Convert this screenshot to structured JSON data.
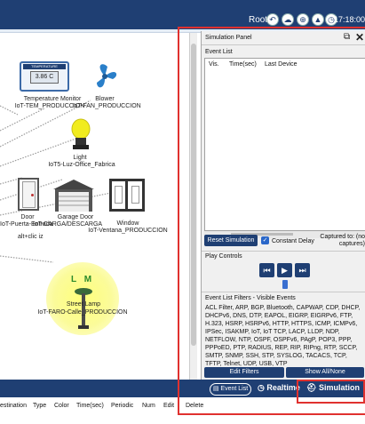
{
  "topbar": {
    "root_label": "Root",
    "time": "17:18:00"
  },
  "devices": [
    {
      "name": "Temperature Monitor",
      "id": "IoT-TEM_PRODUCCION",
      "display": "3.86 C",
      "display_header": "TEMPERATURE"
    },
    {
      "name": "Blower",
      "id": "IoT-FAN_PRODUCCION"
    },
    {
      "name": "Light",
      "id": "IoT5-Luz-Office_Fabrica"
    },
    {
      "name": "Door",
      "id": "IoT-Puerta-Entrada"
    },
    {
      "name": "Garage Door",
      "id": "IoT-CARGA/DESCARGA"
    },
    {
      "name": "Window",
      "id": "IoT-Ventana_PRODUCCION"
    },
    {
      "name": "Street Lamp",
      "id": "IoT-FARO-Calle_PRODUCCION",
      "badge": "L M"
    }
  ],
  "workspace": {
    "hint": "alt+clic iz"
  },
  "sim_panel": {
    "title": "Simulation Panel",
    "event_list_label": "Event List",
    "columns": [
      "Vis.",
      "Time(sec)",
      "Last Device"
    ],
    "reset_label": "Reset Simulation",
    "constant_delay_label": "Constant Delay",
    "captured": "Captured to: (no captures)",
    "play_controls_label": "Play Controls",
    "filter_header": "Event List Filters - Visible Events",
    "filter_list": "ACL Filter, ARP, BGP, Bluetooth, CAPWAP, CDP, DHCP, DHCPv6, DNS, DTP, EAPOL, EIGRP, EIGRPv6, FTP, H.323, HSRP, HSRPv6, HTTP, HTTPS, ICMP, ICMPv6, IPSec, ISAKMP, IoT, IoT TCP, LACP, LLDP, NDP, NETFLOW, NTP, OSPF, OSPFv6, PAgP, POP3, PPP, PPPoED, PTP, RADIUS, REP, RIP, RIPng, RTP, SCCP, SMTP, SNMP, SSH, STP, SYSLOG, TACACS, TCP, TFTP, Telnet, UDP, USB, VTP",
    "edit_filters_label": "Edit Filters",
    "show_all_label": "Show All/None"
  },
  "bottom_tabs": {
    "event_list": "Event List",
    "realtime": "Realtime",
    "simulation": "Simulation"
  },
  "bottom_table": {
    "columns": [
      "estination",
      "Type",
      "Color",
      "Time(sec)",
      "Periodic",
      "Num",
      "Edit",
      "Delete"
    ]
  },
  "colors": {
    "brand": "#1f3f73",
    "highlight": "#e0312f",
    "accent": "#2a67c9"
  }
}
